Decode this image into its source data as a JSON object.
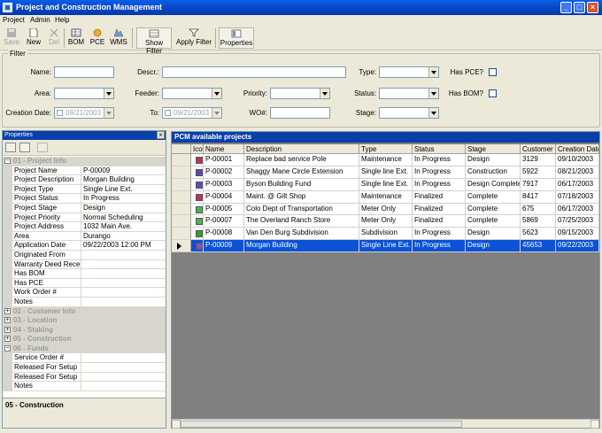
{
  "window": {
    "title": "Project and Construction Management"
  },
  "menu": [
    "Project",
    "Admin",
    "Help"
  ],
  "toolbar": {
    "save": "Save",
    "new": "New",
    "del": "Del",
    "bom": "BOM",
    "pce": "PCE",
    "wms": "WMS",
    "show_filter": "Show Filter",
    "apply_filter": "Apply Filter",
    "properties": "Properties"
  },
  "filter": {
    "legend": "Filter",
    "name_label": "Name:",
    "descr_label": "Descr.:",
    "type_label": "Type:",
    "has_pce_label": "Has PCE?",
    "area_label": "Area:",
    "feeder_label": "Feeder:",
    "priority_label": "Priority:",
    "status_label": "Status:",
    "has_bom_label": "Has BOM?",
    "creation_date_label": "Creation Date:",
    "to_label": "To:",
    "wo_label": "WO#:",
    "stage_label": "Stage:",
    "creation_date_value": "09/21/2003",
    "to_value": "09/21/2003"
  },
  "properties": {
    "header": "Properties",
    "sections": [
      {
        "title": "01 - Project Info",
        "expanded": true,
        "items": [
          {
            "k": "Project Name",
            "v": "P-00009"
          },
          {
            "k": "Project Description",
            "v": "Morgan Building"
          },
          {
            "k": "Project Type",
            "v": "Single Line Ext."
          },
          {
            "k": "Project Status",
            "v": "In Progress"
          },
          {
            "k": "Project Stage",
            "v": "Design"
          },
          {
            "k": "Project Priority",
            "v": "Normal Scheduling"
          },
          {
            "k": "Project Address",
            "v": "1032 Main Ave."
          },
          {
            "k": "Area",
            "v": "Durango"
          },
          {
            "k": "Application Date",
            "v": "09/22/2003 12:00 PM"
          },
          {
            "k": "Originated From",
            "v": ""
          },
          {
            "k": "Warranty Deed Receiv",
            "v": ""
          },
          {
            "k": "Has BOM",
            "v": ""
          },
          {
            "k": "Has PCE",
            "v": ""
          },
          {
            "k": "Work Order #",
            "v": ""
          },
          {
            "k": "Notes",
            "v": ""
          }
        ]
      },
      {
        "title": "02 - Customer Info",
        "expanded": false,
        "items": []
      },
      {
        "title": "03 - Location",
        "expanded": false,
        "items": []
      },
      {
        "title": "04 - Staking",
        "expanded": false,
        "items": []
      },
      {
        "title": "05 - Construction",
        "expanded": false,
        "items": []
      },
      {
        "title": "06 - Funds",
        "expanded": true,
        "items": [
          {
            "k": "Service Order #",
            "v": ""
          },
          {
            "k": "Released For Setup",
            "v": ""
          },
          {
            "k": "Released For Setup By",
            "v": ""
          },
          {
            "k": "Notes",
            "v": ""
          }
        ]
      }
    ],
    "description": "05 - Construction"
  },
  "projects": {
    "caption": "PCM available projects",
    "columns": [
      "Ico",
      "Name",
      "Description",
      "Type",
      "Status",
      "Stage",
      "Customer",
      "Creation Date"
    ],
    "rows": [
      {
        "icon_color": "#c03060",
        "name": "P-00001",
        "description": "Replace bad service Pole",
        "type": "Maintenance",
        "status": "In Progress",
        "stage": "Design",
        "customer": "3129",
        "date": "09/10/2003",
        "selected": false
      },
      {
        "icon_color": "#6040c0",
        "name": "P-00002",
        "description": "Shaggy Mane Circle Extension",
        "type": "Single line Ext.",
        "status": "In Progress",
        "stage": "Construction",
        "customer": "5922",
        "date": "08/21/2003",
        "selected": false
      },
      {
        "icon_color": "#5050c8",
        "name": "P-00003",
        "description": "Byson Building Fund",
        "type": "Single line Ext.",
        "status": "In Progress",
        "stage": "Design Complete",
        "customer": "7917",
        "date": "06/17/2003",
        "selected": false
      },
      {
        "icon_color": "#c03060",
        "name": "P-00004",
        "description": "Maint. @ Gilt Shop",
        "type": "Maintenance",
        "status": "Finalized",
        "stage": "Complete",
        "customer": "8417",
        "date": "07/18/2003",
        "selected": false
      },
      {
        "icon_color": "#50b050",
        "name": "P-00005",
        "description": "Colo Dept of Transportation",
        "type": "Meter Only",
        "status": "Finalized",
        "stage": "Complete",
        "customer": "675",
        "date": "06/17/2003",
        "selected": false
      },
      {
        "icon_color": "#50b050",
        "name": "P-00007",
        "description": "The Overland Ranch Store",
        "type": "Meter Only",
        "status": "Finalized",
        "stage": "Complete",
        "customer": "5869",
        "date": "07/25/2003",
        "selected": false
      },
      {
        "icon_color": "#30a030",
        "name": "P-00008",
        "description": "Van Den Burg Subdivision",
        "type": "Subdivision",
        "status": "In Progress",
        "stage": "Design",
        "customer": "5623",
        "date": "09/15/2003",
        "selected": false
      },
      {
        "icon_color": "#8050c8",
        "name": "P-00009",
        "description": "Morgan Building",
        "type": "Single Line Ext.",
        "status": "In Progress",
        "stage": "Design",
        "customer": "45653",
        "date": "09/22/2003",
        "selected": true
      }
    ]
  }
}
